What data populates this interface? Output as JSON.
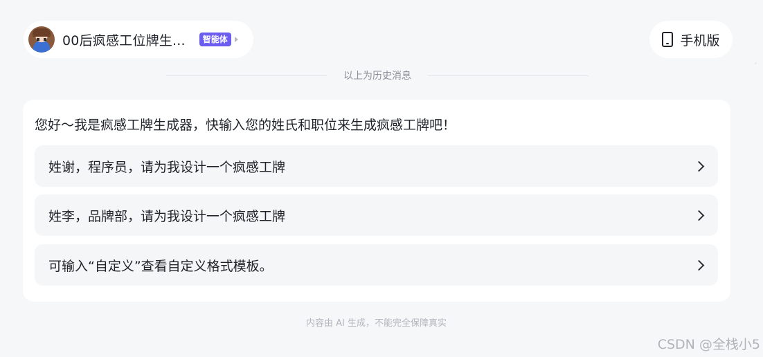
{
  "header": {
    "agent_name": "00后疯感工位牌生...",
    "agent_badge": "智能体",
    "mobile_label": "手机版"
  },
  "history": {
    "divider_text": "以上为历史消息"
  },
  "message": {
    "greeting": "您好～我是疯感工牌生成器，快输入您的姓氏和职位来生成疯感工牌吧！",
    "suggestions": [
      {
        "label": "姓谢，程序员，请为我设计一个疯感工牌"
      },
      {
        "label": "姓李，品牌部，请为我设计一个疯感工牌"
      },
      {
        "label": "可输入“自定义”查看自定义格式模板。"
      }
    ]
  },
  "footer": {
    "disclaimer": "内容由 AI 生成，不能完全保障真实"
  },
  "watermark": {
    "text": "CSDN @全栈小5"
  },
  "colors": {
    "background": "#f6f7f9",
    "card": "#ffffff",
    "suggestion_bg": "#f5f6f8",
    "badge": "#6c5cf0",
    "text_primary": "#1f2329",
    "text_muted": "#8a8f98"
  }
}
